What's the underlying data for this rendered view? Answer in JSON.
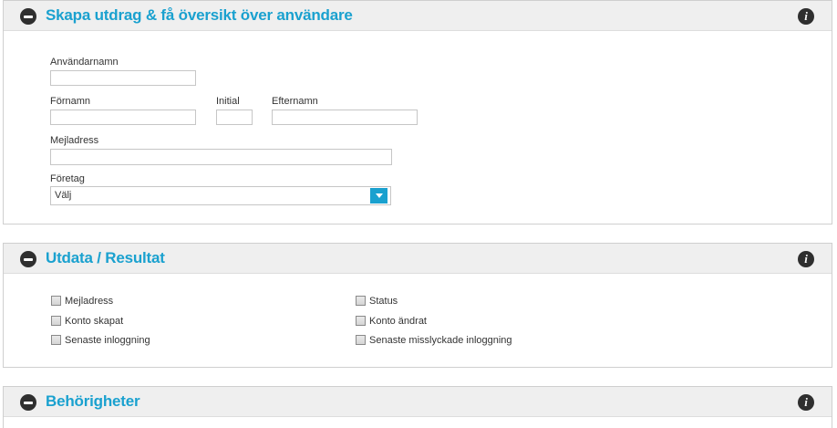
{
  "sections": [
    {
      "title": "Skapa utdrag & få översikt över användare",
      "info": "i"
    },
    {
      "title": "Utdata / Resultat",
      "info": "i"
    },
    {
      "title": "Behörigheter",
      "info": "i"
    }
  ],
  "form": {
    "username_label": "Användarnamn",
    "username_value": "",
    "firstname_label": "Förnamn",
    "firstname_value": "",
    "initial_label": "Initial",
    "initial_value": "",
    "lastname_label": "Efternamn",
    "lastname_value": "",
    "email_label": "Mejladress",
    "email_value": "",
    "company_label": "Företag",
    "company_selected": "Välj"
  },
  "output": {
    "left": [
      {
        "label": "Mejladress",
        "checked": false
      },
      {
        "label": "Konto skapat",
        "checked": false
      },
      {
        "label": "Senaste inloggning",
        "checked": false
      }
    ],
    "right": [
      {
        "label": "Status",
        "checked": false
      },
      {
        "label": "Konto ändrat",
        "checked": false
      },
      {
        "label": "Senaste misslyckade inloggning",
        "checked": false
      }
    ]
  },
  "colors": {
    "accent": "#1aa1cf",
    "header_bg": "#efefef",
    "icon": "#2f2f2f"
  }
}
